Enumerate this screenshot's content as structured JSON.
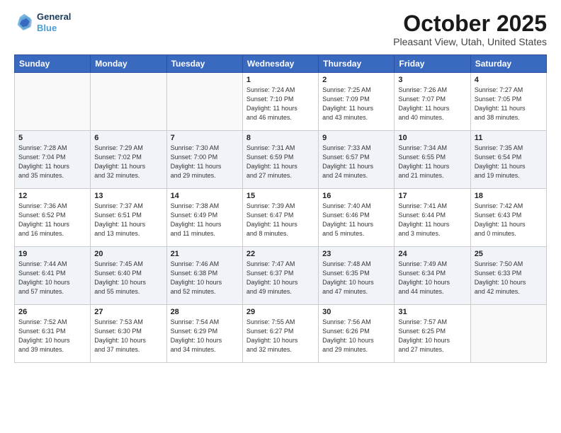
{
  "logo": {
    "line1": "General",
    "line2": "Blue"
  },
  "title": "October 2025",
  "location": "Pleasant View, Utah, United States",
  "days_of_week": [
    "Sunday",
    "Monday",
    "Tuesday",
    "Wednesday",
    "Thursday",
    "Friday",
    "Saturday"
  ],
  "weeks": [
    [
      {
        "day": "",
        "info": ""
      },
      {
        "day": "",
        "info": ""
      },
      {
        "day": "",
        "info": ""
      },
      {
        "day": "1",
        "info": "Sunrise: 7:24 AM\nSunset: 7:10 PM\nDaylight: 11 hours\nand 46 minutes."
      },
      {
        "day": "2",
        "info": "Sunrise: 7:25 AM\nSunset: 7:09 PM\nDaylight: 11 hours\nand 43 minutes."
      },
      {
        "day": "3",
        "info": "Sunrise: 7:26 AM\nSunset: 7:07 PM\nDaylight: 11 hours\nand 40 minutes."
      },
      {
        "day": "4",
        "info": "Sunrise: 7:27 AM\nSunset: 7:05 PM\nDaylight: 11 hours\nand 38 minutes."
      }
    ],
    [
      {
        "day": "5",
        "info": "Sunrise: 7:28 AM\nSunset: 7:04 PM\nDaylight: 11 hours\nand 35 minutes."
      },
      {
        "day": "6",
        "info": "Sunrise: 7:29 AM\nSunset: 7:02 PM\nDaylight: 11 hours\nand 32 minutes."
      },
      {
        "day": "7",
        "info": "Sunrise: 7:30 AM\nSunset: 7:00 PM\nDaylight: 11 hours\nand 29 minutes."
      },
      {
        "day": "8",
        "info": "Sunrise: 7:31 AM\nSunset: 6:59 PM\nDaylight: 11 hours\nand 27 minutes."
      },
      {
        "day": "9",
        "info": "Sunrise: 7:33 AM\nSunset: 6:57 PM\nDaylight: 11 hours\nand 24 minutes."
      },
      {
        "day": "10",
        "info": "Sunrise: 7:34 AM\nSunset: 6:55 PM\nDaylight: 11 hours\nand 21 minutes."
      },
      {
        "day": "11",
        "info": "Sunrise: 7:35 AM\nSunset: 6:54 PM\nDaylight: 11 hours\nand 19 minutes."
      }
    ],
    [
      {
        "day": "12",
        "info": "Sunrise: 7:36 AM\nSunset: 6:52 PM\nDaylight: 11 hours\nand 16 minutes."
      },
      {
        "day": "13",
        "info": "Sunrise: 7:37 AM\nSunset: 6:51 PM\nDaylight: 11 hours\nand 13 minutes."
      },
      {
        "day": "14",
        "info": "Sunrise: 7:38 AM\nSunset: 6:49 PM\nDaylight: 11 hours\nand 11 minutes."
      },
      {
        "day": "15",
        "info": "Sunrise: 7:39 AM\nSunset: 6:47 PM\nDaylight: 11 hours\nand 8 minutes."
      },
      {
        "day": "16",
        "info": "Sunrise: 7:40 AM\nSunset: 6:46 PM\nDaylight: 11 hours\nand 5 minutes."
      },
      {
        "day": "17",
        "info": "Sunrise: 7:41 AM\nSunset: 6:44 PM\nDaylight: 11 hours\nand 3 minutes."
      },
      {
        "day": "18",
        "info": "Sunrise: 7:42 AM\nSunset: 6:43 PM\nDaylight: 11 hours\nand 0 minutes."
      }
    ],
    [
      {
        "day": "19",
        "info": "Sunrise: 7:44 AM\nSunset: 6:41 PM\nDaylight: 10 hours\nand 57 minutes."
      },
      {
        "day": "20",
        "info": "Sunrise: 7:45 AM\nSunset: 6:40 PM\nDaylight: 10 hours\nand 55 minutes."
      },
      {
        "day": "21",
        "info": "Sunrise: 7:46 AM\nSunset: 6:38 PM\nDaylight: 10 hours\nand 52 minutes."
      },
      {
        "day": "22",
        "info": "Sunrise: 7:47 AM\nSunset: 6:37 PM\nDaylight: 10 hours\nand 49 minutes."
      },
      {
        "day": "23",
        "info": "Sunrise: 7:48 AM\nSunset: 6:35 PM\nDaylight: 10 hours\nand 47 minutes."
      },
      {
        "day": "24",
        "info": "Sunrise: 7:49 AM\nSunset: 6:34 PM\nDaylight: 10 hours\nand 44 minutes."
      },
      {
        "day": "25",
        "info": "Sunrise: 7:50 AM\nSunset: 6:33 PM\nDaylight: 10 hours\nand 42 minutes."
      }
    ],
    [
      {
        "day": "26",
        "info": "Sunrise: 7:52 AM\nSunset: 6:31 PM\nDaylight: 10 hours\nand 39 minutes."
      },
      {
        "day": "27",
        "info": "Sunrise: 7:53 AM\nSunset: 6:30 PM\nDaylight: 10 hours\nand 37 minutes."
      },
      {
        "day": "28",
        "info": "Sunrise: 7:54 AM\nSunset: 6:29 PM\nDaylight: 10 hours\nand 34 minutes."
      },
      {
        "day": "29",
        "info": "Sunrise: 7:55 AM\nSunset: 6:27 PM\nDaylight: 10 hours\nand 32 minutes."
      },
      {
        "day": "30",
        "info": "Sunrise: 7:56 AM\nSunset: 6:26 PM\nDaylight: 10 hours\nand 29 minutes."
      },
      {
        "day": "31",
        "info": "Sunrise: 7:57 AM\nSunset: 6:25 PM\nDaylight: 10 hours\nand 27 minutes."
      },
      {
        "day": "",
        "info": ""
      }
    ]
  ]
}
